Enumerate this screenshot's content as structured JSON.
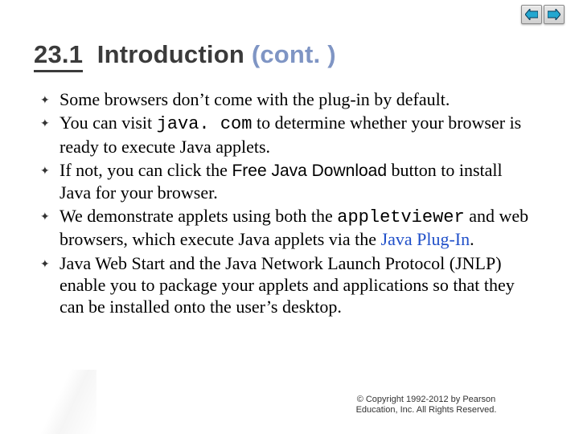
{
  "nav": {
    "prev_label": "previous",
    "next_label": "next"
  },
  "title": {
    "number": "23.1",
    "heading": "Introduction",
    "cont": "(cont. )"
  },
  "bullets": [
    {
      "pre": "Some browsers don’t come with the plug-in by default."
    },
    {
      "pre": "You can visit ",
      "mono": "java. com",
      "post": " to determine whether your browser is ready to execute Java applets."
    },
    {
      "pre": "If not, you can click the ",
      "sans": "Free Java Download",
      "post": " button to install Java for your browser."
    },
    {
      "pre": "We demonstrate applets using both the ",
      "mono": "appletviewer",
      "post": " and web browsers, which execute Java applets via the ",
      "link": "Java Plug-In",
      "tail": "."
    },
    {
      "pre": "Java Web Start and the Java Network Launch Protocol (JNLP) enable you to package your applets and applications so that they can be installed onto the user’s desktop."
    }
  ],
  "footer": {
    "line1": "© Copyright 1992-2012 by Pearson",
    "line2": "Education, Inc. All Rights Reserved."
  },
  "icons": {
    "arrow_fill": "#24a7d0",
    "arrow_stroke": "#0b3b57"
  }
}
